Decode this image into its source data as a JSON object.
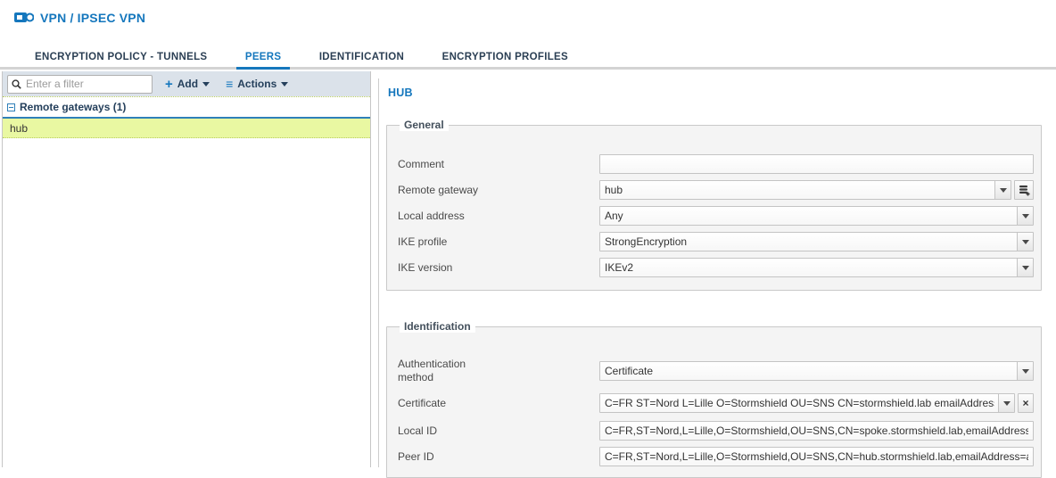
{
  "colors": {
    "accent_blue": "#1577bd",
    "tab_text": "#2b3f54",
    "toolbar_bg": "#dbe2ea",
    "selected_row_bg": "#e9f8a2",
    "fieldset_bg": "#f4f4f4",
    "tab_underline_gray": "#d3d3d3"
  },
  "icons": {
    "module": "monitor-icon",
    "search": "magnifier",
    "add_glyph": "+",
    "actions_glyph": "≡",
    "collapse": "minus-box",
    "dropdown": "caret-down",
    "clear_glyph": "×",
    "add_object": "object-stack-plus"
  },
  "header": {
    "title": "VPN / IPSEC VPN"
  },
  "tabs": [
    {
      "label": "ENCRYPTION POLICY - TUNNELS",
      "active": false
    },
    {
      "label": "PEERS",
      "active": true
    },
    {
      "label": "IDENTIFICATION",
      "active": false
    },
    {
      "label": "ENCRYPTION PROFILES",
      "active": false
    }
  ],
  "left_panel": {
    "filter_placeholder": "Enter a filter",
    "add_label": "Add",
    "actions_label": "Actions",
    "tree": {
      "group_label": "Remote gateways (1)",
      "items": [
        {
          "name": "hub",
          "selected": true
        }
      ]
    }
  },
  "detail": {
    "title": "HUB",
    "general": {
      "legend": "General",
      "comment": {
        "label": "Comment",
        "value": ""
      },
      "remote_gateway": {
        "label": "Remote gateway",
        "value": "hub"
      },
      "local_address": {
        "label": "Local address",
        "value": "Any"
      },
      "ike_profile": {
        "label": "IKE profile",
        "value": "StrongEncryption"
      },
      "ike_version": {
        "label": "IKE version",
        "value": "IKEv2"
      }
    },
    "identification": {
      "legend": "Identification",
      "auth_method": {
        "label": "Authentication method",
        "value": "Certificate"
      },
      "certificate": {
        "label": "Certificate",
        "value": "C=FR ST=Nord L=Lille O=Stormshield OU=SNS CN=stormshield.lab emailAddress=ad"
      },
      "local_id": {
        "label": "Local ID",
        "value": "C=FR,ST=Nord,L=Lille,O=Stormshield,OU=SNS,CN=spoke.stormshield.lab,emailAddress=adm"
      },
      "peer_id": {
        "label": "Peer ID",
        "value": "C=FR,ST=Nord,L=Lille,O=Stormshield,OU=SNS,CN=hub.stormshield.lab,emailAddress=admi"
      }
    }
  }
}
